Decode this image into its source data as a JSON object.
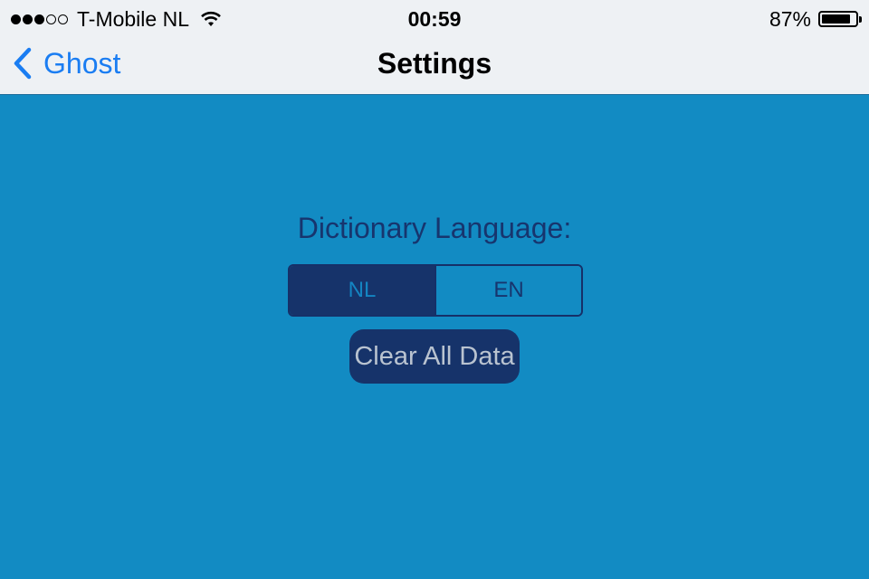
{
  "status_bar": {
    "signal_bars_filled": 3,
    "signal_bars_total": 5,
    "carrier": "T-Mobile NL",
    "time": "00:59",
    "battery_percent": "87%",
    "battery_level": 0.87,
    "wifi_icon": "wifi-icon",
    "battery_icon": "battery-icon"
  },
  "nav_bar": {
    "back_label": "Ghost",
    "back_icon": "chevron-left-icon",
    "title": "Settings"
  },
  "settings": {
    "language_label": "Dictionary Language:",
    "language_options": [
      "NL",
      "EN"
    ],
    "selected_language": "NL",
    "clear_button_label": "Clear All Data"
  },
  "colors": {
    "background": "#128bc3",
    "navbar_background": "#eef1f4",
    "accent_dark": "#16336a",
    "link_blue": "#1a7df2"
  }
}
